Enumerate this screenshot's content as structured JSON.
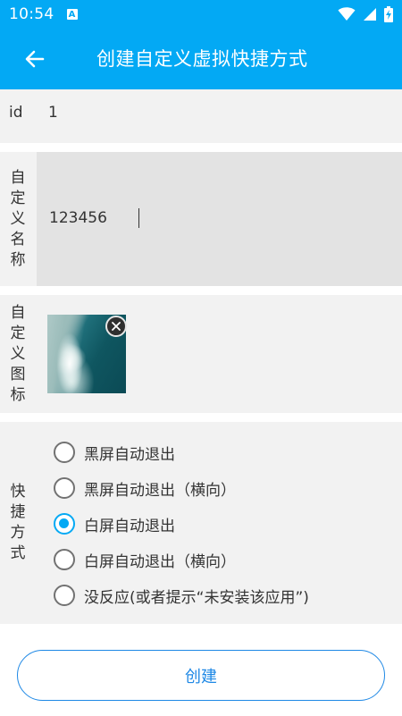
{
  "status_bar": {
    "time": "10:54",
    "notification_icon": "A"
  },
  "app_bar": {
    "title": "创建自定义虚拟快捷方式",
    "back_icon": "arrow-left-icon",
    "background_color": "#03a9f4"
  },
  "id_row": {
    "label": "id",
    "value": "1"
  },
  "name_row": {
    "label": "自定义名称",
    "value": "123456"
  },
  "icon_row": {
    "label": "自定义图标",
    "clear_icon": "close-circle-icon"
  },
  "type_row": {
    "label": "快捷方式",
    "options": [
      {
        "label": "黑屏自动退出",
        "checked": false
      },
      {
        "label": "黑屏自动退出（横向）",
        "checked": false
      },
      {
        "label": "白屏自动退出",
        "checked": true
      },
      {
        "label": "白屏自动退出（横向）",
        "checked": false
      },
      {
        "label": "没反应(或者提示“未安装该应用”)",
        "checked": false
      }
    ],
    "accent_color": "#03a9f4"
  },
  "create_button": {
    "label": "创建",
    "color": "#1e88e5"
  }
}
